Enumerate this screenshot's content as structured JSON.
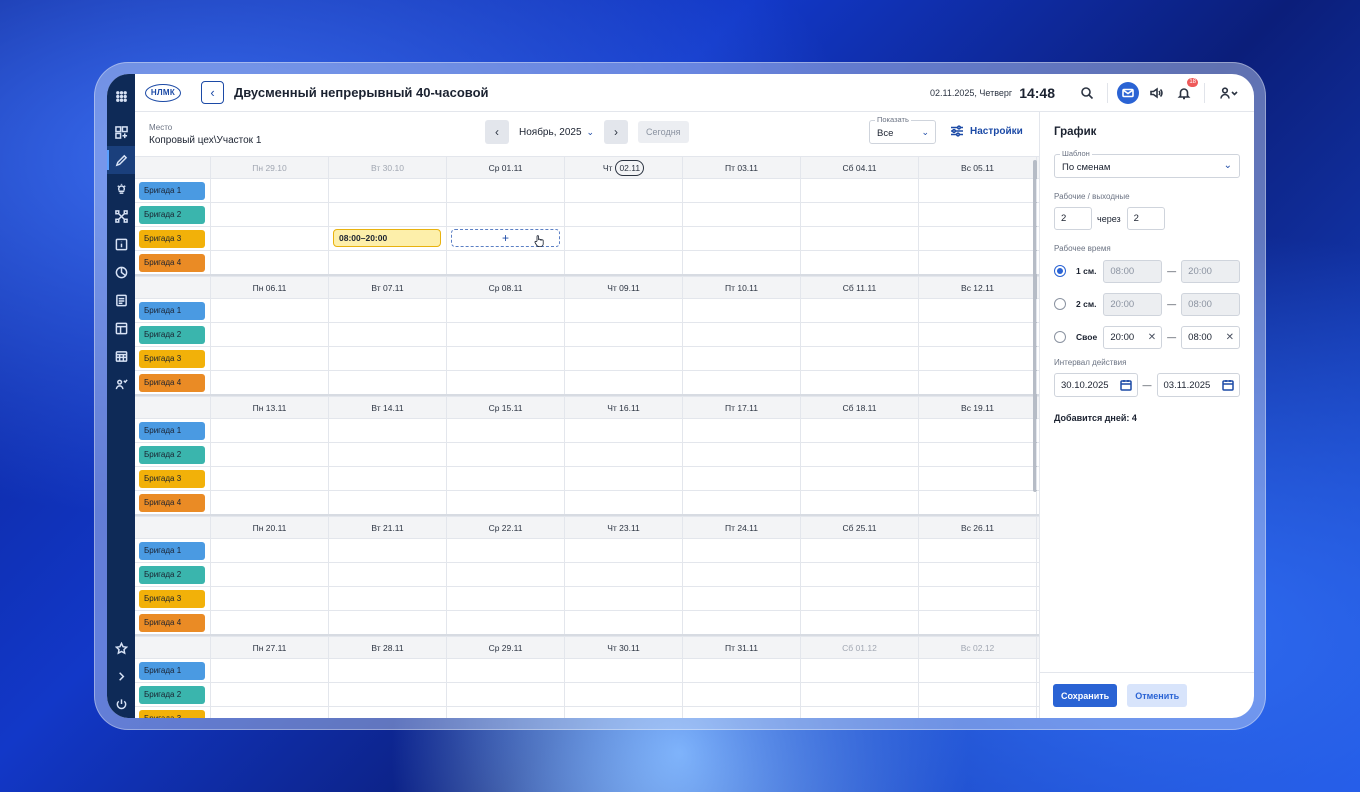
{
  "header": {
    "logo": "НЛМК",
    "title": "Двусменный непрерывный 40-часовой",
    "date": "02.11.2025, Четверг",
    "time": "14:48",
    "notifications_count": "18"
  },
  "toolbar": {
    "place_label": "Место",
    "place_value": "Копровый цех\\Участок 1",
    "month": "Ноябрь, 2025",
    "today": "Сегодня",
    "show_label": "Показать",
    "show_value": "Все",
    "settings": "Настройки"
  },
  "teams": [
    {
      "name": "Бригада 1",
      "color": "#4a9ae2"
    },
    {
      "name": "Бригада 2",
      "color": "#3ab5ad"
    },
    {
      "name": "Бригада 3",
      "color": "#f2b109"
    },
    {
      "name": "Бригада 4",
      "color": "#ea8b25"
    }
  ],
  "weeks": [
    {
      "days": [
        "Пн 29.10",
        "Вт 30.10",
        "Ср 01.11",
        "Чт",
        "Пт 03.11",
        "Сб 04.11",
        "Вс 05.11"
      ],
      "today_num": "02.11"
    },
    {
      "days": [
        "Пн 06.11",
        "Вт 07.11",
        "Ср 08.11",
        "Чт 09.11",
        "Пт 10.11",
        "Сб 11.11",
        "Вс 12.11"
      ]
    },
    {
      "days": [
        "Пн 13.11",
        "Вт 14.11",
        "Ср 15.11",
        "Чт 16.11",
        "Пт 17.11",
        "Сб 18.11",
        "Вс 19.11"
      ]
    },
    {
      "days": [
        "Пн 20.11",
        "Вт 21.11",
        "Ср 22.11",
        "Чт 23.11",
        "Пт 24.11",
        "Сб 25.11",
        "Вс 26.11"
      ]
    },
    {
      "days": [
        "Пн 27.11",
        "Вт 28.11",
        "Ср 29.11",
        "Чт 30.11",
        "Пт 31.11",
        "Сб 01.12",
        "Вс 02.12"
      ]
    }
  ],
  "shift_chip": "08:00–20:00",
  "add_chip": "+",
  "panel": {
    "title": "График",
    "template_label": "Шаблон",
    "template_value": "По сменам",
    "workdays_label": "Рабочие / выходные",
    "work_days": "2",
    "through": "через",
    "off_days": "2",
    "work_time_label": "Рабочее время",
    "shifts": [
      {
        "name": "1 см.",
        "from": "08:00",
        "to": "20:00",
        "selected": true
      },
      {
        "name": "2 см.",
        "from": "20:00",
        "to": "08:00",
        "selected": false
      },
      {
        "name": "Свое",
        "from": "20:00",
        "to": "08:00",
        "selected": false
      }
    ],
    "interval_label": "Интервал действия",
    "interval_from": "30.10.2025",
    "interval_to": "03.11.2025",
    "added_days": "Добавится дней: 4",
    "save": "Сохранить",
    "cancel": "Отменить"
  }
}
